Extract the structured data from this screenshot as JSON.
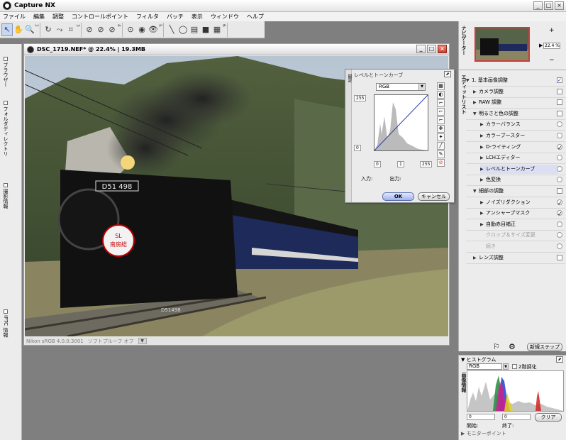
{
  "app": {
    "title": "Capture NX",
    "min": "_",
    "max": "□",
    "close": "×"
  },
  "menu": [
    "ファイル",
    "編集",
    "調整",
    "コントロールポイント",
    "フィルタ",
    "バッチ",
    "表示",
    "ウィンドウ",
    "ヘルプ"
  ],
  "toolbar": {
    "groups": [
      "2",
      "3",
      "4",
      "5",
      "6"
    ]
  },
  "left_tabs": {
    "browser": "ブラウザー",
    "folders": "フォルダディレクトリ",
    "metadata": "撮影情報",
    "iptc": "IPTC 情報"
  },
  "image_window": {
    "title": "DSC_1719.NEF* @ 22.4% | 19.3MB",
    "status_profile": "Nikon sRGB 4.0.0.3001",
    "status_softproof": "ソフトプルーフ オフ",
    "loco_plate": "D51 498",
    "loco_number": "D51498",
    "headboard_top": "SL",
    "headboard_bottom": "南房総"
  },
  "curves": {
    "side": "設定",
    "title": "レベルとトーンカーブ",
    "channel": "RGB",
    "max_out": "255",
    "min_out": "0",
    "in_black": "0",
    "in_mid": "1",
    "in_white": "255",
    "input_label": "入力:",
    "output_label": "出力:",
    "ok": "OK",
    "cancel": "キャンセル"
  },
  "navigator": {
    "label": "ナビゲーター",
    "zoom": "22.4 %",
    "zoom_in": "+",
    "zoom_out": "−"
  },
  "edit_list": {
    "label": "エディットリスト",
    "items": [
      {
        "label": "1. 基本画像調整",
        "level": 0,
        "arrow": "▼"
      },
      {
        "label": "カメラ調整",
        "level": 1,
        "arrow": "▶"
      },
      {
        "label": "RAW 調整",
        "level": 1,
        "arrow": "▶"
      },
      {
        "label": "明るさと色の調整",
        "level": 1,
        "arrow": "▼"
      },
      {
        "label": "カラーバランス",
        "level": 2,
        "arrow": "▶"
      },
      {
        "label": "カラーブースター",
        "level": 2,
        "arrow": "▶"
      },
      {
        "label": "D-ライティング",
        "level": 2,
        "arrow": "▶"
      },
      {
        "label": "LCHエディター",
        "level": 2,
        "arrow": "▶"
      },
      {
        "label": "レベルとトーンカーブ",
        "level": 2,
        "arrow": "▶"
      },
      {
        "label": "色変換",
        "level": 2,
        "arrow": "▶"
      },
      {
        "label": "細部の調整",
        "level": 1,
        "arrow": "▼"
      },
      {
        "label": "ノイズリダクション",
        "level": 2,
        "arrow": "▶"
      },
      {
        "label": "アンシャープマスク",
        "level": 2,
        "arrow": "▶"
      },
      {
        "label": "自動赤目補正",
        "level": 2,
        "arrow": "▶"
      },
      {
        "label": "クロップ＆サイズ変更",
        "level": 2,
        "arrow": ""
      },
      {
        "label": "続き",
        "level": 2,
        "arrow": ""
      },
      {
        "label": "レンズ調整",
        "level": 1,
        "arrow": "▶"
      }
    ],
    "check": "✓",
    "new_step": "新規ステップ"
  },
  "histogram": {
    "label": "ヒストグラム",
    "side": "画像情報",
    "channel": "RGB",
    "two_point": "2階調化",
    "start_val": "0",
    "end_val": "0",
    "start_label": "開始:",
    "end_label": "終了:",
    "clear": "クリア",
    "monitor_point": "モニターポイント"
  },
  "colors": {
    "accent": "#2b3ea0",
    "close_red": "#d23b2a",
    "panel": "#ececec"
  }
}
